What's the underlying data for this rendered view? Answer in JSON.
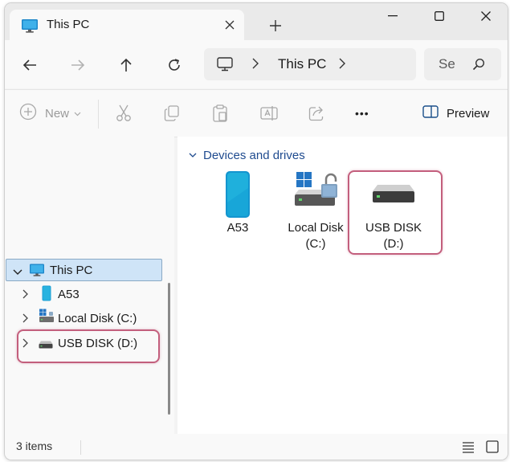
{
  "window": {
    "tab_title": "This PC",
    "tab_icon": "monitor-icon"
  },
  "navigation": {
    "address_icon": "monitor-icon",
    "address_path": "This PC",
    "search_placeholder": "Se"
  },
  "toolbar": {
    "new_label": "New",
    "more_label": "•••",
    "preview_label": "Preview"
  },
  "sidebar": {
    "items": [
      {
        "label": "This PC",
        "icon": "monitor-icon",
        "selected": true
      },
      {
        "label": "A53",
        "icon": "phone-icon"
      },
      {
        "label": "Local Disk (C:)",
        "icon": "windows-drive-icon"
      },
      {
        "label": "USB DISK (D:)",
        "icon": "usb-drive-icon",
        "highlighted": true
      }
    ]
  },
  "main": {
    "group_title": "Devices and drives",
    "drives": [
      {
        "line1": "A53",
        "line2": "",
        "icon": "phone-icon"
      },
      {
        "line1": "Local Disk",
        "line2": "(C:)",
        "icon": "windows-drive-lock-icon"
      },
      {
        "line1": "USB DISK",
        "line2": "(D:)",
        "icon": "usb-drive-icon",
        "highlighted": true
      }
    ]
  },
  "status": {
    "item_count": "3 items"
  },
  "colors": {
    "highlight": "#c35f7d",
    "selection": "#cfe4f7",
    "group_title": "#1f4b8f",
    "phone": "#1e9fd4"
  }
}
